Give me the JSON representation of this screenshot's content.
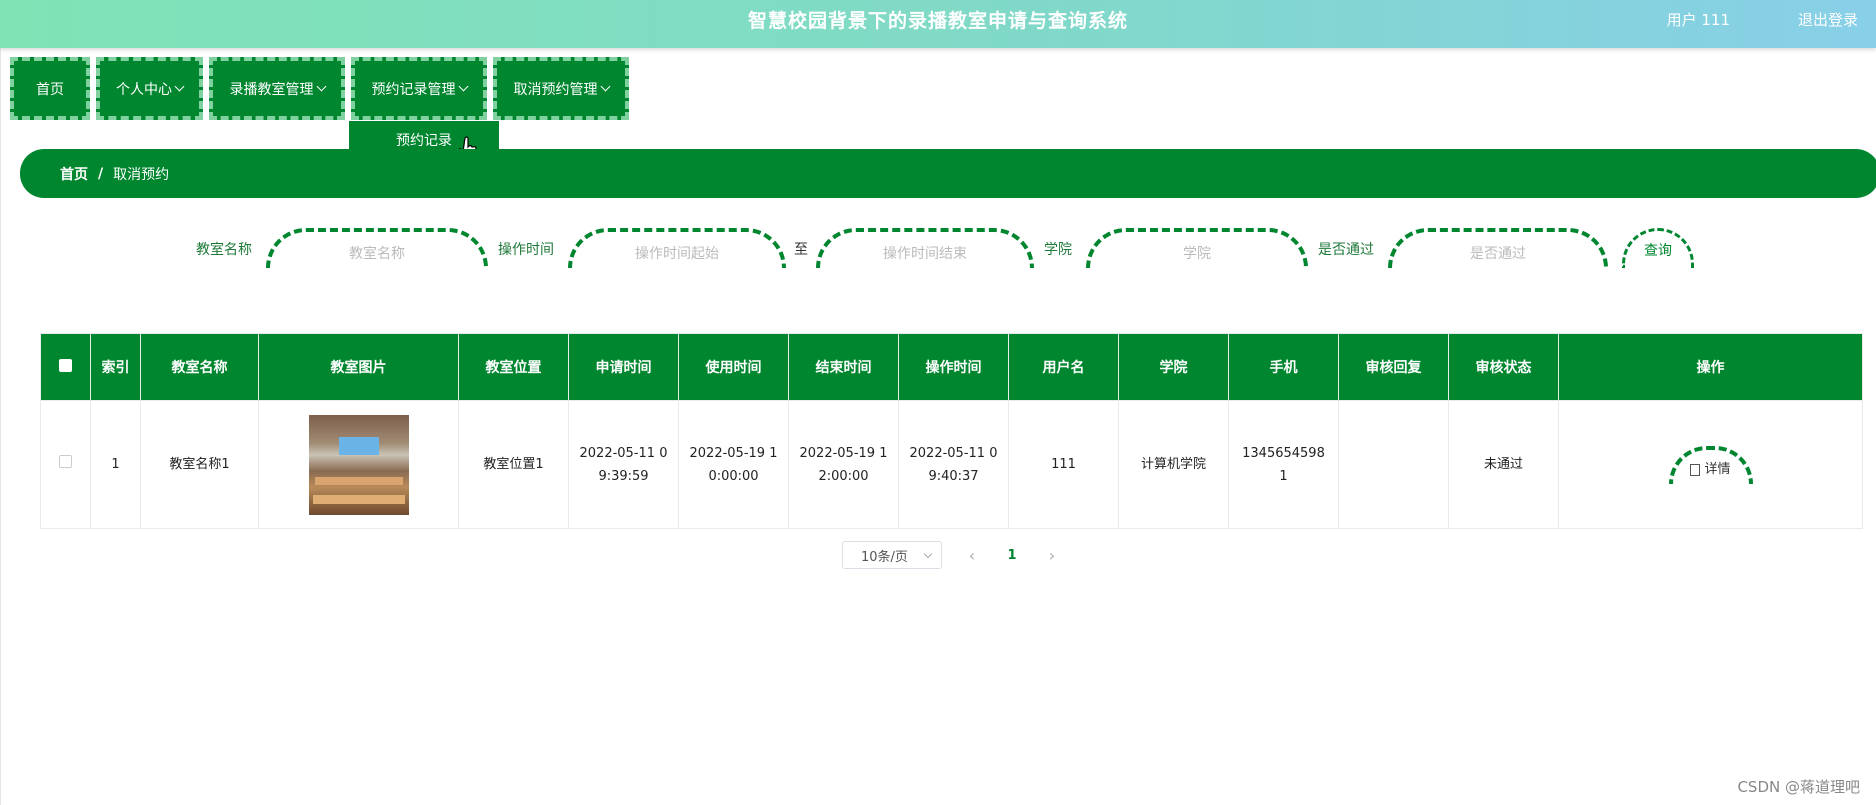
{
  "header": {
    "title": "智慧校园背景下的录播教室申请与查询系统",
    "user_label": "用户 111",
    "logout_label": "退出登录"
  },
  "nav": {
    "items": [
      {
        "label": "首页"
      },
      {
        "label": "个人中心"
      },
      {
        "label": "录播教室管理"
      },
      {
        "label": "预约记录管理"
      },
      {
        "label": "取消预约管理"
      }
    ],
    "open_dropdown_item": "预约记录"
  },
  "breadcrumb": {
    "home": "首页",
    "separator": "/",
    "current": "取消预约"
  },
  "search": {
    "classroom_label": "教室名称",
    "classroom_placeholder": "教室名称",
    "optime_label": "操作时间",
    "optime_start_placeholder": "操作时间起始",
    "to_label": "至",
    "optime_end_placeholder": "操作时间结束",
    "college_label": "学院",
    "college_placeholder": "学院",
    "passed_label": "是否通过",
    "passed_placeholder": "是否通过",
    "query_button": "查询"
  },
  "table": {
    "headers": [
      "索引",
      "教室名称",
      "教室图片",
      "教室位置",
      "申请时间",
      "使用时间",
      "结束时间",
      "操作时间",
      "用户名",
      "学院",
      "手机",
      "审核回复",
      "审核状态",
      "操作"
    ],
    "rows": [
      {
        "index": "1",
        "name": "教室名称1",
        "location": "教室位置1",
        "apply_time": "2022-05-11 09:39:59",
        "use_time": "2022-05-19 10:00:00",
        "end_time": "2022-05-19 12:00:00",
        "op_time": "2022-05-11 09:40:37",
        "username": "111",
        "college": "计算机学院",
        "phone": "13456545981",
        "reply": "",
        "status": "未通过",
        "action": "详情"
      }
    ]
  },
  "pagination": {
    "page_size": "10条/页",
    "current_page": "1",
    "prev": "‹",
    "next": "›"
  },
  "watermark": "CSDN @蒋道理吧",
  "colors": {
    "primary": "#00862f",
    "header_gradient_start": "#7fe3b6",
    "header_gradient_end": "#88cfe8"
  }
}
